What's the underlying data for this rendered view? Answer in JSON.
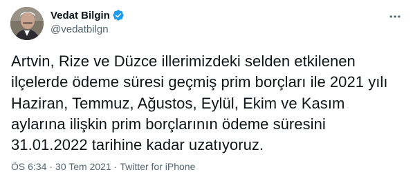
{
  "author": {
    "display_name": "Vedat Bilgin",
    "handle": "@vedatbilgn",
    "verified": true
  },
  "tweet": {
    "text": "Artvin, Rize ve Düzce illerimizdeki selden etkilenen\nilçelerde ödeme süresi geçmiş prim borçları ile 2021 yılı\nHaziran, Temmuz, Ağustos, Eylül, Ekim ve Kasım\naylarına ilişkin prim borçlarının ödeme süresini\n31.01.2022 tarihine kadar uzatıyoruz."
  },
  "meta": {
    "time": "ÖS 6:34",
    "date": "30 Tem 2021",
    "source": "Twitter for iPhone",
    "separator": "·"
  },
  "icons": {
    "more": "more-horizontal-icon",
    "verified": "verified-badge-icon"
  },
  "colors": {
    "text_primary": "#0f1419",
    "text_secondary": "#536471",
    "verified_blue": "#1d9bf0",
    "background": "#ffffff"
  }
}
